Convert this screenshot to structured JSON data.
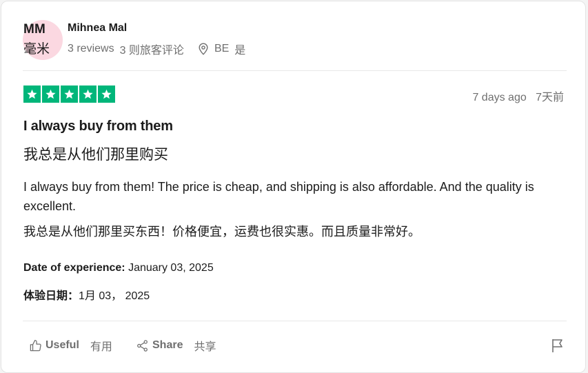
{
  "reviewer": {
    "initials": "MM",
    "initials_zh": "毫米",
    "name": "Mihnea Mal",
    "reviews": "3 reviews",
    "reviews_zh": "3 则旅客评论",
    "country": "BE",
    "country_zh": "是"
  },
  "review": {
    "rating": 5,
    "date_ago": "7 days ago",
    "date_ago_zh": "7天前",
    "title": "I always buy from them",
    "title_zh": "我总是从他们那里购买",
    "body": "I always buy from them! The price is cheap, and shipping is also affordable. And the quality is excellent.",
    "body_zh": "我总是从他们那里买东西！价格便宜，运费也很实惠。而且质量非常好。",
    "experience_label": "Date of experience:",
    "experience_value": "January 03, 2025",
    "experience_label_zh": "体验日期：",
    "experience_value_zh": "1月 03， 2025"
  },
  "actions": {
    "useful": "Useful",
    "useful_zh": "有用",
    "share": "Share",
    "share_zh": "共享"
  },
  "colors": {
    "star_green": "#00b67a",
    "avatar_bg": "#fbd8e1"
  },
  "icons": [
    "star-icon",
    "location-pin-icon",
    "thumbs-up-icon",
    "share-icon",
    "flag-icon"
  ]
}
